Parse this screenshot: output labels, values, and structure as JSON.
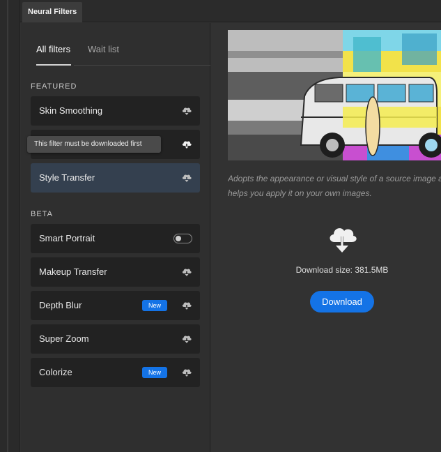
{
  "window": {
    "tab_title": "Neural Filters"
  },
  "subtabs": [
    {
      "label": "All filters",
      "active": true
    },
    {
      "label": "Wait list",
      "active": false
    }
  ],
  "sections": {
    "featured": "FEATURED",
    "beta": "BETA"
  },
  "featured_items": [
    {
      "label": "Skin Smoothing",
      "icon": "cloud-download-icon"
    },
    {
      "label": "",
      "icon": "cloud-download-icon"
    },
    {
      "label": "Style Transfer",
      "icon": "cloud-download-icon",
      "selected": true
    }
  ],
  "beta_items": [
    {
      "label": "Smart Portrait",
      "control": "toggle",
      "toggle_on": false
    },
    {
      "label": "Makeup Transfer",
      "icon": "cloud-download-icon"
    },
    {
      "label": "Depth Blur",
      "badge": "New",
      "icon": "cloud-download-icon"
    },
    {
      "label": "Super Zoom",
      "icon": "cloud-download-icon"
    },
    {
      "label": "Colorize",
      "badge": "New",
      "icon": "cloud-download-icon"
    }
  ],
  "tooltip": "This filter must be downloaded first",
  "detail": {
    "description_line1": "Adopts the appearance or visual style of a source image a",
    "description_line2": "helps you apply it on your own images.",
    "download_size": "Download size: 381.5MB",
    "download_button": "Download",
    "icon": "cloud-download-icon"
  },
  "colors": {
    "accent": "#1473e6",
    "selected_item": "#34404f",
    "item_bg": "#222222",
    "panel_bg": "#2f2f2f"
  }
}
